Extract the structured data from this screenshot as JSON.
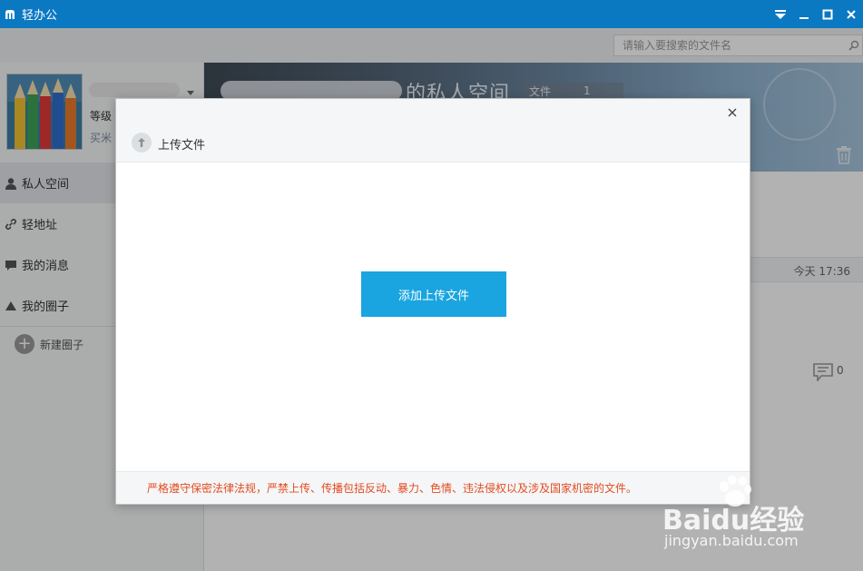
{
  "app": {
    "title": "轻办公",
    "colors": {
      "titlebar": "#0b78c2",
      "accent": "#1aa5e0",
      "warning": "#e24c1f"
    }
  },
  "search": {
    "placeholder": "请输入要搜索的文件名"
  },
  "sidebar": {
    "level_label": "等级",
    "points_label": "买米",
    "items": [
      {
        "label": "私人空间",
        "icon": "person-icon",
        "active": true
      },
      {
        "label": "轻地址",
        "icon": "link-icon"
      },
      {
        "label": "我的消息",
        "icon": "message-icon"
      },
      {
        "label": "我的圈子",
        "icon": "triangle-icon"
      }
    ],
    "new_circle_label": "新建圈子"
  },
  "main": {
    "banner_title": "的私人空间",
    "banner_badge_label": "文件",
    "banner_badge_count": "1",
    "file_time": "今天 17:36",
    "comment_count": "0"
  },
  "modal": {
    "title": "上传文件",
    "add_button": "添加上传文件",
    "warning": "严格遵守保密法律法规，严禁上传、传播包括反动、暴力、色情、违法侵权以及涉及国家机密的文件。"
  },
  "watermark": {
    "main": "Baidu经验",
    "sub": "jingyan.baidu.com"
  }
}
